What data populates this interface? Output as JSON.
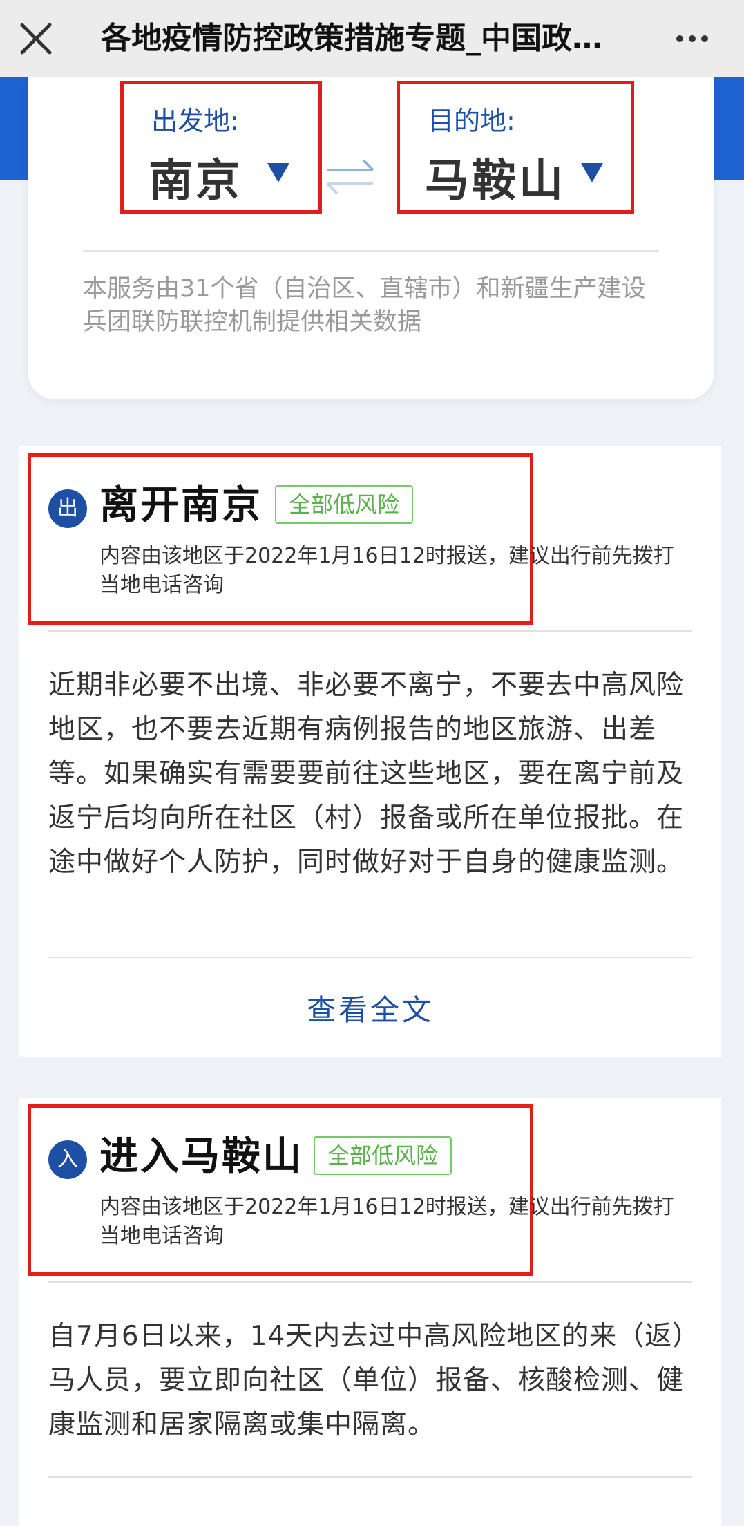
{
  "nav": {
    "title": "各地疫情防控政策措施专题_中国政…",
    "close_icon": "close-icon",
    "more_icon": "more-icon"
  },
  "route": {
    "from_label": "出发地:",
    "from_city": "南京",
    "to_label": "目的地:",
    "to_city": "马鞍山",
    "swap_icon": "swap-arrows-icon",
    "note": "本服务由31个省（自治区、直辖市）和新疆生产建设兵团联防联控机制提供相关数据"
  },
  "leave": {
    "badge": "出",
    "title": "离开南京",
    "risk": "全部低风险",
    "meta": "内容由该地区于2022年1月16日12时报送，建议出行前先拨打当地电话咨询",
    "body": "近期非必要不出境、非必要不离宁，不要去中高风险地区，也不要去近期有病例报告的地区旅游、出差等。如果确实有需要要前往这些地区，要在离宁前及返宁后均向所在社区（村）报备或所在单位报批。在途中做好个人防护，同时做好对于自身的健康监测。",
    "view_full": "查看全文"
  },
  "enter": {
    "badge": "入",
    "title": "进入马鞍山",
    "risk": "全部低风险",
    "meta": "内容由该地区于2022年1月16日12时报送，建议出行前先拨打当地电话咨询",
    "body": "自7月6日以来，14天内去过中高风险地区的来（返）马人员，要立即向社区（单位）报备、核酸检测、健康监测和居家隔离或集中隔离。"
  },
  "colors": {
    "accent_blue": "#1d4fa4",
    "header_blue": "#1e61d1",
    "highlight_red": "#e01e1e",
    "risk_green": "#5bb24d"
  }
}
